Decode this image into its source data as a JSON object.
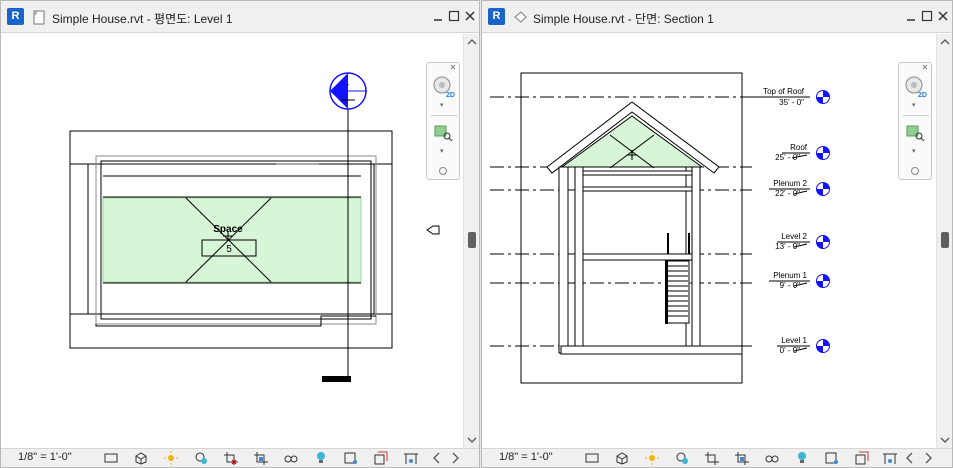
{
  "left_view": {
    "title": "Simple House.rvt - 평면도: Level 1",
    "scale": "1/8\" = 1'-0\"",
    "space_label": "Space",
    "space_number": "5"
  },
  "right_view": {
    "title": "Simple House.rvt - 단면: Section 1",
    "scale": "1/8\" = 1'-0\"",
    "levels": [
      {
        "name": "Top of Roof",
        "elevation": "35' - 0\""
      },
      {
        "name": "Roof",
        "elevation": "25' - 0\""
      },
      {
        "name": "Plenum 2",
        "elevation": "22' - 0\""
      },
      {
        "name": "Level 2",
        "elevation": "13' - 0\""
      },
      {
        "name": "Plenum 1",
        "elevation": "9' - 0\""
      },
      {
        "name": "Level 1",
        "elevation": "0' - 0\""
      }
    ]
  },
  "icons": {
    "app": "R",
    "window_controls": [
      "minimize-icon",
      "restore-icon",
      "close-icon"
    ],
    "status_tools": [
      "detail-level-icon",
      "visual-style-icon",
      "sun-path-icon",
      "shadows-icon",
      "crop-view-icon",
      "show-crop-icon",
      "temporary-hide-icon",
      "reveal-hidden-icon",
      "analytical-model-icon",
      "highlight-displacement-icon",
      "worksharing-icon"
    ]
  },
  "colors": {
    "accent_blue": "#1a63c9",
    "space_fill": "#d7f5d7",
    "level_marker": "#1313ff"
  }
}
